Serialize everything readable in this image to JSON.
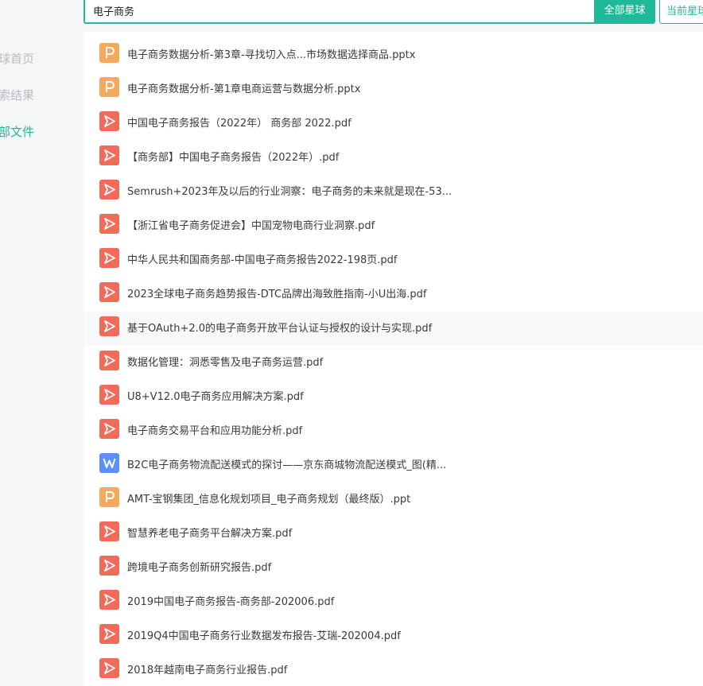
{
  "search": {
    "value": "电子商务",
    "all_planets_label": "全部星球",
    "current_planet_label": "当前星球"
  },
  "sidebar": {
    "items": [
      {
        "label": "球首页",
        "active": false
      },
      {
        "label": "索结果",
        "active": false
      },
      {
        "label": "部文件",
        "active": true
      }
    ]
  },
  "colors": {
    "accent": "#1fb999",
    "pdf_icon": "#f26a5a",
    "ppt_icon": "#f4a95c",
    "word_icon": "#5b8ff9"
  },
  "files": [
    {
      "name": "电子商务数据分析-第3章-寻找切入点...市场数据选择商品.pptx",
      "type": "ppt"
    },
    {
      "name": "电子商务数据分析-第1章电商运营与数据分析.pptx",
      "type": "ppt"
    },
    {
      "name": "中国电子商务报告（2022年） 商务部 2022.pdf",
      "type": "pdf"
    },
    {
      "name": "【商务部】中国电子商务报告（2022年）.pdf",
      "type": "pdf"
    },
    {
      "name": "Semrush+2023年及以后的行业洞察：电子商务的未来就是现在-53...",
      "type": "pdf"
    },
    {
      "name": "【浙江省电子商务促进会】中国宠物电商行业洞察.pdf",
      "type": "pdf"
    },
    {
      "name": "中华人民共和国商务部-中国电子商务报告2022-198页.pdf",
      "type": "pdf"
    },
    {
      "name": "2023全球电子商务趋势报告-DTC品牌出海致胜指南-小U出海.pdf",
      "type": "pdf"
    },
    {
      "name": "基于OAuth+2.0的电子商务开放平台认证与授权的设计与实现.pdf",
      "type": "pdf",
      "hover": true
    },
    {
      "name": "数据化管理：洞悉零售及电子商务运营.pdf",
      "type": "pdf"
    },
    {
      "name": "U8+V12.0电子商务应用解决方案.pdf",
      "type": "pdf"
    },
    {
      "name": "电子商务交易平台和应用功能分析.pdf",
      "type": "pdf"
    },
    {
      "name": "B2C电子商务物流配送模式的探讨——京东商城物流配送模式_图(精...",
      "type": "word"
    },
    {
      "name": "AMT-宝钢集团_信息化规划项目_电子商务规划（最终版）.ppt",
      "type": "ppt"
    },
    {
      "name": "智慧养老电子商务平台解决方案.pdf",
      "type": "pdf"
    },
    {
      "name": "跨境电子商务创新研究报告.pdf",
      "type": "pdf"
    },
    {
      "name": "2019中国电子商务报告-商务部-202006.pdf",
      "type": "pdf"
    },
    {
      "name": "2019Q4中国电子商务行业数据发布报告-艾瑞-202004.pdf",
      "type": "pdf"
    },
    {
      "name": "2018年越南电子商务行业报告.pdf",
      "type": "pdf"
    }
  ]
}
